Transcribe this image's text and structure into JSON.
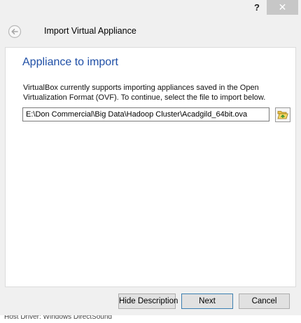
{
  "titlebar": {
    "help_label": "?",
    "close_label": "✕"
  },
  "header": {
    "title": "Import Virtual Appliance",
    "back_icon": "back-arrow-icon"
  },
  "panel": {
    "heading": "Appliance to import",
    "description": "VirtualBox currently supports importing appliances saved in the Open Virtualization Format (OVF). To continue, select the file to import below.",
    "file_value": "E:\\Don Commercial\\Big Data\\Hadoop Cluster\\Acadgild_64bit.ova",
    "browse_icon": "folder-open-icon"
  },
  "buttons": {
    "hide_description": "Hide Description",
    "next": "Next",
    "cancel": "Cancel"
  },
  "background": {
    "text": "Host Driver:  Windows DirectSound"
  },
  "colors": {
    "heading": "#1f4fa6",
    "window_bg": "#f0f0f0",
    "close_button": "#c7c7c7",
    "default_button_border": "#3c7fb1"
  }
}
